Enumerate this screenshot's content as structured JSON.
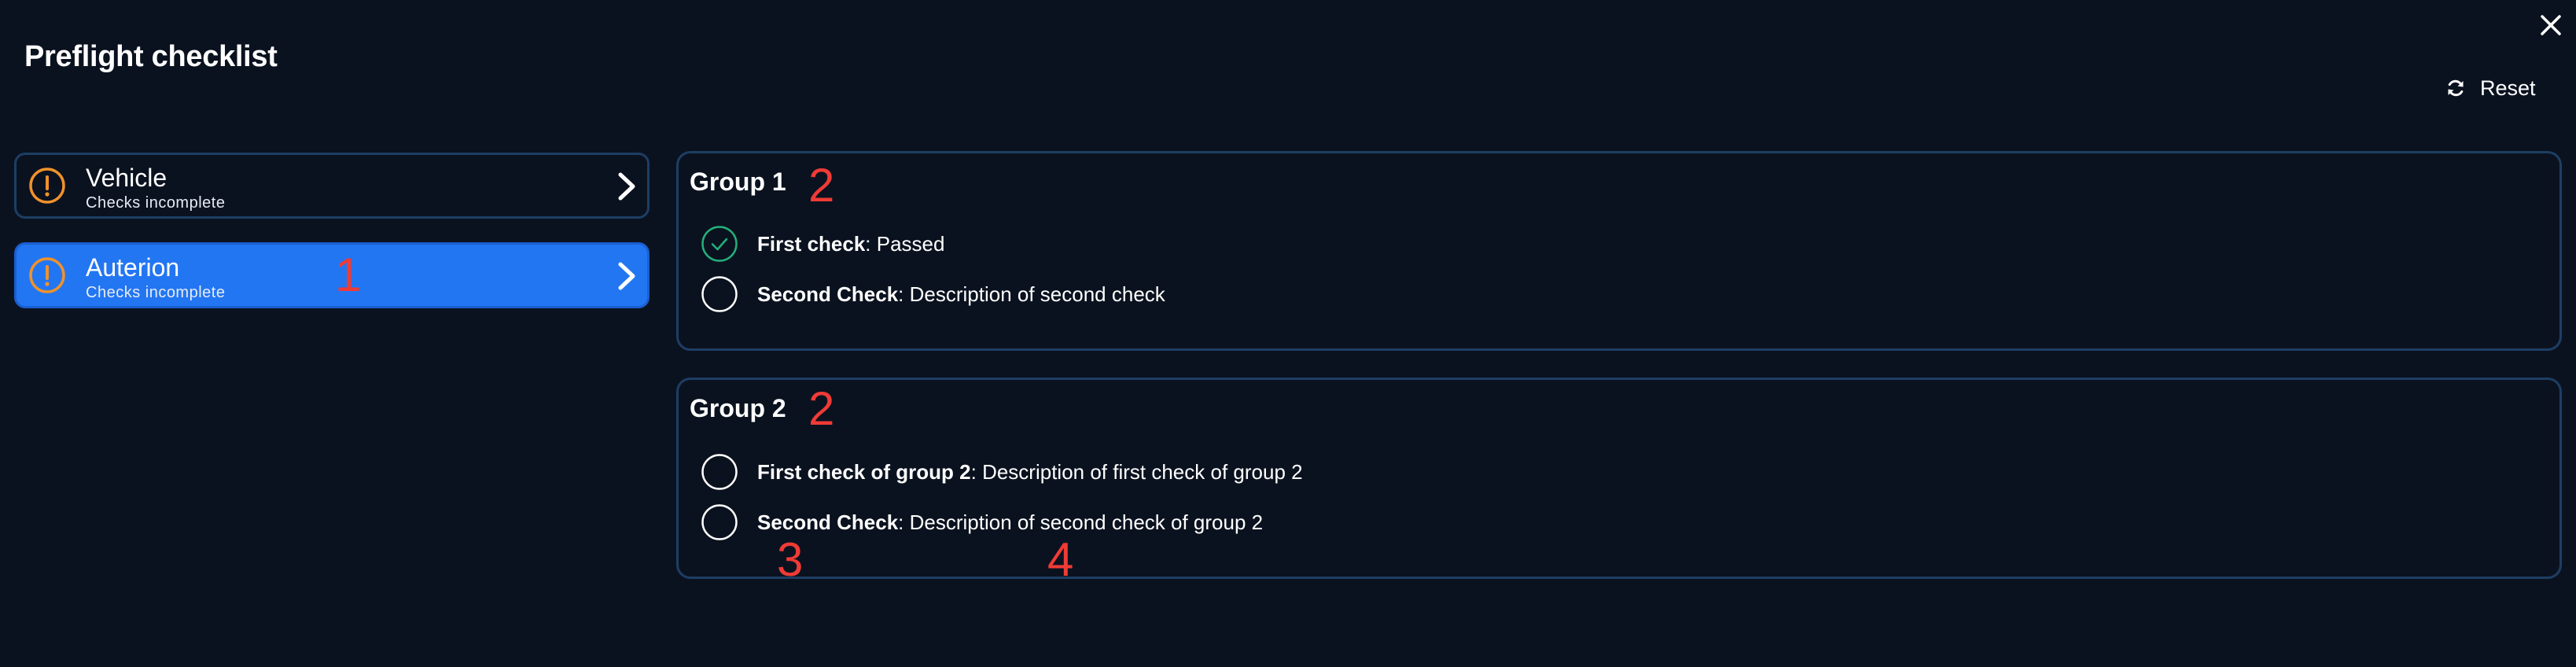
{
  "header": {
    "title": "Preflight checklist",
    "reset_label": "Reset"
  },
  "colors": {
    "background": "#0b121f",
    "panel_border": "#1d3e64",
    "active_blue": "#2376f2",
    "warning_orange": "#f0922b",
    "pass_green": "#23b07a",
    "annotation_red": "#ef3b36"
  },
  "icons": {
    "close": "close-icon",
    "reset": "refresh-icon",
    "warning": "exclamation-circle-icon",
    "chevron": "chevron-right-icon",
    "passed": "check-circle-icon",
    "pending": "empty-circle-icon"
  },
  "steps": [
    {
      "title": "Vehicle",
      "subtitle": "Checks incomplete",
      "active": false
    },
    {
      "title": "Auterion",
      "subtitle": "Checks incomplete",
      "active": true
    }
  ],
  "groups": [
    {
      "title": "Group 1",
      "checks": [
        {
          "name": "First check",
          "separator": ": ",
          "description": "Passed",
          "passed": true
        },
        {
          "name": "Second Check",
          "separator": ": ",
          "description": "Description of second check",
          "passed": false
        }
      ]
    },
    {
      "title": "Group 2",
      "checks": [
        {
          "name": "First check of group 2",
          "separator": ": ",
          "description": "Description of first check of group 2",
          "passed": false
        },
        {
          "name": "Second Check",
          "separator": ": ",
          "description": "Description of second check of group 2",
          "passed": false
        }
      ]
    }
  ],
  "annotations": [
    "1",
    "2",
    "2",
    "3",
    "4"
  ]
}
